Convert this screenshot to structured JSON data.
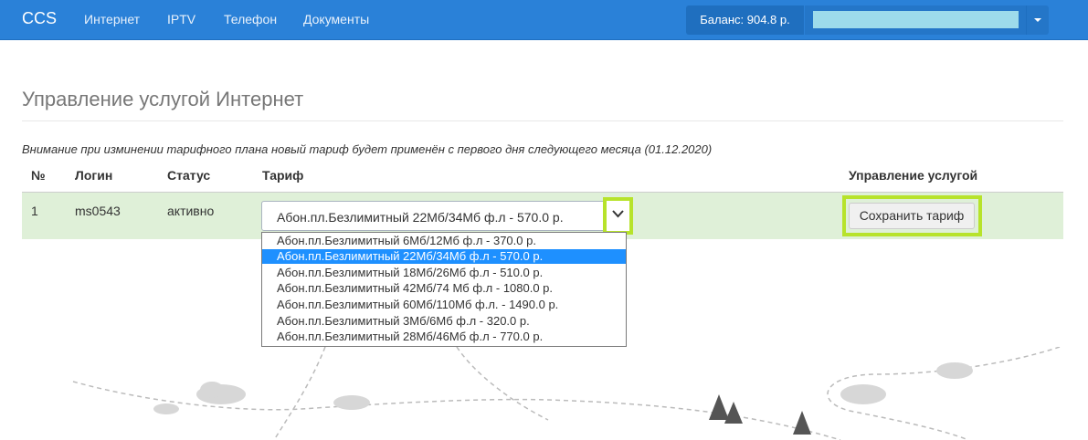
{
  "navbar": {
    "brand": "CCS",
    "links": [
      "Интернет",
      "IPTV",
      "Телефон",
      "Документы"
    ],
    "balance": "Баланс: 904.8 р."
  },
  "page": {
    "title": "Управление услугой Интернет",
    "notice": "Внимание при изминении тарифного плана новый тариф будет применён с первого дня следующего месяца (01.12.2020)"
  },
  "table": {
    "headers": [
      "№",
      "Логин",
      "Статус",
      "Тариф",
      "Управление услугой"
    ],
    "row": {
      "num": "1",
      "login": "ms0543",
      "status": "активно",
      "tariff": "Абон.пл.Безлимитный 22Мб/34Мб ф.л - 570.0 р.",
      "action": "Сохранить тариф"
    }
  },
  "dropdown": {
    "options": [
      "Абон.пл.Безлимитный 6Мб/12Мб ф.л - 370.0 р.",
      "Абон.пл.Безлимитный 22Мб/34Мб ф.л - 570.0 р.",
      "Абон.пл.Безлимитный 18Мб/26Мб ф.л - 510.0 р.",
      "Абон.пл.Безлимитный 42Мб/74 Мб ф.л - 1080.0 р.",
      "Абон.пл.Безлимитный 60Мб/110Мб ф.л. - 1490.0 р.",
      "Абон.пл.Безлимитный 3Мб/6Мб ф.л - 320.0 р.",
      "Абон.пл.Безлимитный 28Мб/46Мб ф.л - 770.0 р."
    ],
    "selected_index": 1
  },
  "colors": {
    "navbar": "#2a81d8",
    "row_highlight": "#dff0d8",
    "annotation_highlight": "#b7e32b",
    "option_selected": "#1e90ff"
  }
}
